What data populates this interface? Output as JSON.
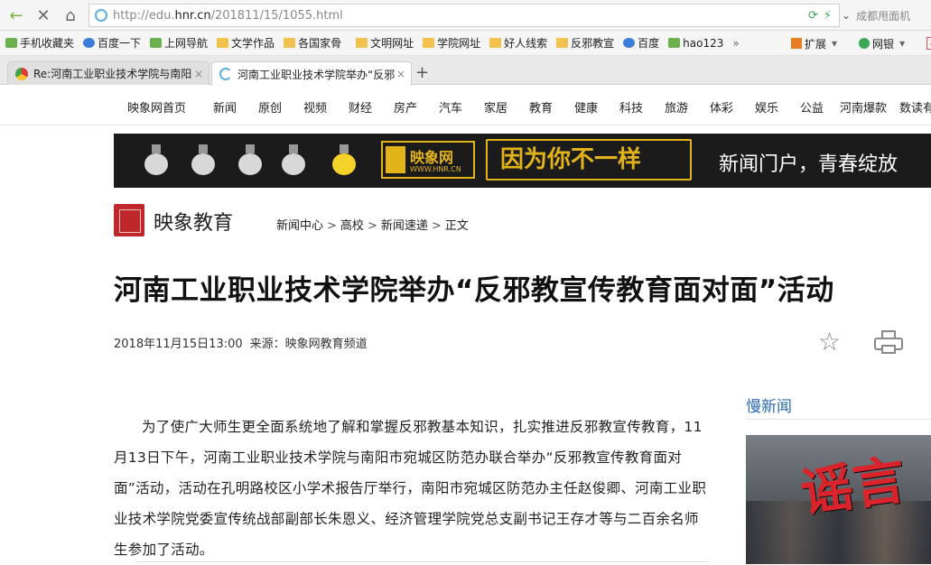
{
  "browser": {
    "url_prefix": "http://edu.",
    "url_domain": "hnr.cn",
    "url_path": "/201811/15/1055.html",
    "addr_tail_text": "成都甩面机"
  },
  "bookmarks": [
    {
      "label": "手机收藏夹",
      "icon": "phone-icon"
    },
    {
      "label": "百度一下",
      "icon": "baidu-icon"
    },
    {
      "label": "上网导航",
      "icon": "hao123-icon"
    },
    {
      "label": "文学作品",
      "icon": "folder-icon"
    },
    {
      "label": "各国家骨",
      "icon": "folder-icon"
    },
    {
      "label": "文明网址",
      "icon": "folder-icon"
    },
    {
      "label": "学院网址",
      "icon": "folder-icon"
    },
    {
      "label": "好人线索",
      "icon": "folder-icon"
    },
    {
      "label": "反邪教宣",
      "icon": "folder-icon"
    },
    {
      "label": "百度",
      "icon": "baidu-icon"
    },
    {
      "label": "hao123",
      "icon": "hao123-icon"
    }
  ],
  "bookmark_more": "»",
  "bookmark_right": {
    "extend": "扩展",
    "bank": "网银"
  },
  "tabs": [
    {
      "label": "Re:河南工业职业技术学院与南阳",
      "close": "×"
    },
    {
      "label": "河南工业职业技术学院举办“反邪",
      "close": "×"
    }
  ],
  "newtab": "+",
  "site_nav": [
    "映象网首页",
    "新闻",
    "原创",
    "视频",
    "财经",
    "房产",
    "汽车",
    "家居",
    "教育",
    "健康",
    "科技",
    "旅游",
    "体彩",
    "娱乐",
    "公益",
    "河南爆款",
    "数读有"
  ],
  "banner": {
    "logo_text": "映象网",
    "logo_url": "WWW.HNR.CN",
    "slogan": "因为你不一样",
    "tagline": "新闻门户，青春绽放"
  },
  "channel": {
    "name": "映象教育",
    "breadcrumbs": [
      "新闻中心",
      "高校",
      "新闻速递",
      "正文"
    ],
    "breadcrumb_sep": ">"
  },
  "article": {
    "title": "河南工业职业技术学院举办“反邪教宣传教育面对面”活动",
    "date": "2018年11月15日13:00",
    "source": "来源：映象网教育频道",
    "body": "为了使广大师生更全面系统地了解和掌握反邪教基本知识，扎实推进反邪教宣传教育，11月13日下午，河南工业职业技术学院与南阳市宛城区防范办联合举办“反邪教宣传教育面对面”活动，活动在孔明路校区小学术报告厅举行，南阳市宛城区防范办主任赵俊卿、河南工业职业技术学院党委宣传统战部副部长朱恩义、经济管理学院党总支副书记王存才等与二百余名师生参加了活动。"
  },
  "sidebar": {
    "heading": "慢新闻",
    "photo_caption": "谣言"
  },
  "colors": {
    "accent_blue": "#2b6cb0",
    "banner_gold": "#e3b41a",
    "seal_red": "#c0272d"
  }
}
